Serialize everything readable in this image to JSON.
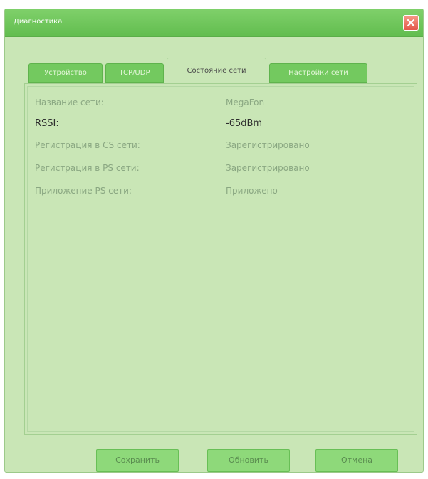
{
  "window": {
    "title": "Диагностика"
  },
  "tabs": [
    {
      "label": "Устройство",
      "active": false
    },
    {
      "label": "TCP/UDP",
      "active": false
    },
    {
      "label": "Состояние сети",
      "active": true
    },
    {
      "label": "Настройки сети",
      "active": false
    }
  ],
  "rows": [
    {
      "label": "Название сети:",
      "value": "MegaFon"
    },
    {
      "label": "RSSI:",
      "value": "-65dBm"
    },
    {
      "label": "Регистрация в CS сети:",
      "value": "Зарегистрировано"
    },
    {
      "label": "Регистрация в PS сети:",
      "value": "Зарегистрировано"
    },
    {
      "label": "Приложение PS сети:",
      "value": "Приложено"
    }
  ],
  "buttons": {
    "save": "Сохранить",
    "refresh": "Обновить",
    "cancel": "Отмена"
  },
  "colors": {
    "titlebar": "#6cc459",
    "background": "#c9e6b6",
    "close": "#e4584a"
  },
  "icons": {
    "close": "close-icon"
  }
}
